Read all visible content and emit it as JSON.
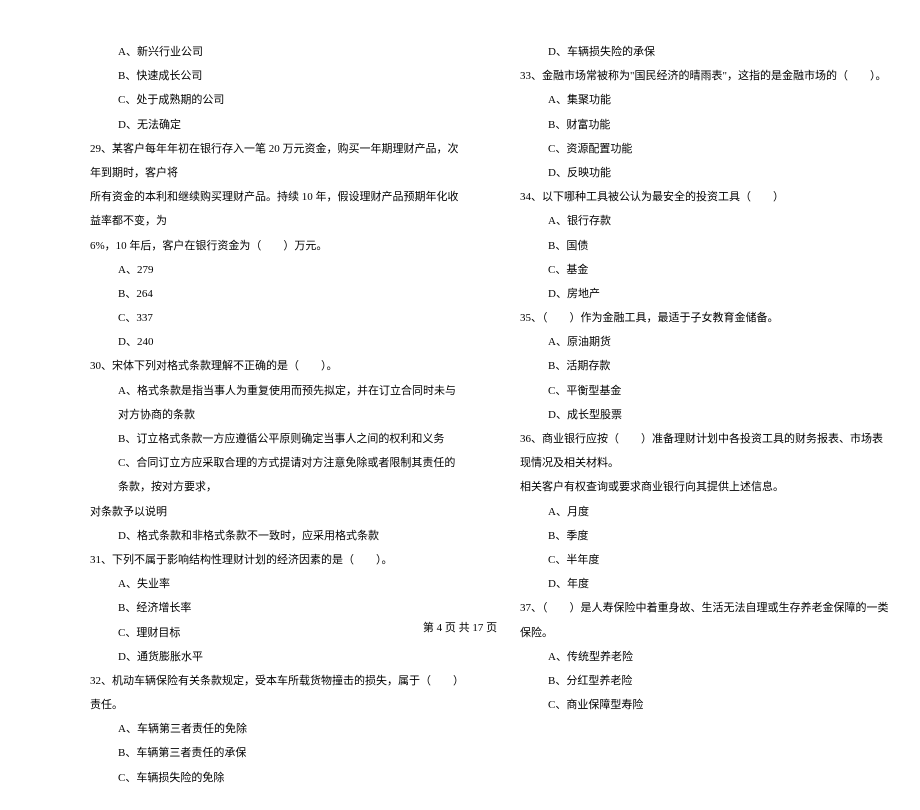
{
  "leftColumn": {
    "opts28": [
      "A、新兴行业公司",
      "B、快速成长公司",
      "C、处于成熟期的公司",
      "D、无法确定"
    ],
    "q29_l1": "29、某客户每年年初在银行存入一笔 20 万元资金，购买一年期理财产品，次年到期时，客户将",
    "q29_l2": "所有资金的本利和继续购买理财产品。持续 10 年，假设理财产品预期年化收益率都不变，为",
    "q29_l3": "6%，10 年后，客户在银行资金为（　　）万元。",
    "opts29": [
      "A、279",
      "B、264",
      "C、337",
      "D、240"
    ],
    "q30": "30、宋体下列对格式条款理解不正确的是（　　）。",
    "opts30_a": "A、格式条款是指当事人为重复使用而预先拟定，并在订立合同时未与对方协商的条款",
    "opts30_b": "B、订立格式条款一方应遵循公平原则确定当事人之间的权利和义务",
    "opts30_c": "C、合同订立方应采取合理的方式提请对方注意免除或者限制其责任的条款，按对方要求，",
    "opts30_c2": "对条款予以说明",
    "opts30_d": "D、格式条款和非格式条款不一致时，应采用格式条款",
    "q31": "31、下列不属于影响结构性理财计划的经济因素的是（　　）。",
    "opts31": [
      "A、失业率",
      "B、经济增长率",
      "C、理财目标",
      "D、通货膨胀水平"
    ],
    "q32": "32、机动车辆保险有关条款规定，受本车所载货物撞击的损失，属于（　　）责任。",
    "opts32": [
      "A、车辆第三者责任的免除",
      "B、车辆第三者责任的承保",
      "C、车辆损失险的免除"
    ]
  },
  "rightColumn": {
    "opts32d": "D、车辆损失险的承保",
    "q33": "33、金融市场常被称为\"国民经济的晴雨表\"，这指的是金融市场的（　　）。",
    "opts33": [
      "A、集聚功能",
      "B、财富功能",
      "C、资源配置功能",
      "D、反映功能"
    ],
    "q34": "34、以下哪种工具被公认为最安全的投资工具（　　）",
    "opts34": [
      "A、银行存款",
      "B、国债",
      "C、基金",
      "D、房地产"
    ],
    "q35": "35、（　　）作为金融工具，最适于子女教育金储备。",
    "opts35": [
      "A、原油期货",
      "B、活期存款",
      "C、平衡型基金",
      "D、成长型股票"
    ],
    "q36_l1": "36、商业银行应按（　　）准备理财计划中各投资工具的财务报表、市场表现情况及相关材料。",
    "q36_l2": "相关客户有权查询或要求商业银行向其提供上述信息。",
    "opts36": [
      "A、月度",
      "B、季度",
      "C、半年度",
      "D、年度"
    ],
    "q37": "37、（　　）是人寿保险中着重身故、生活无法自理或生存养老金保障的一类保险。",
    "opts37": [
      "A、传统型养老险",
      "B、分红型养老险",
      "C、商业保障型寿险"
    ]
  },
  "footer": "第 4 页 共 17 页"
}
